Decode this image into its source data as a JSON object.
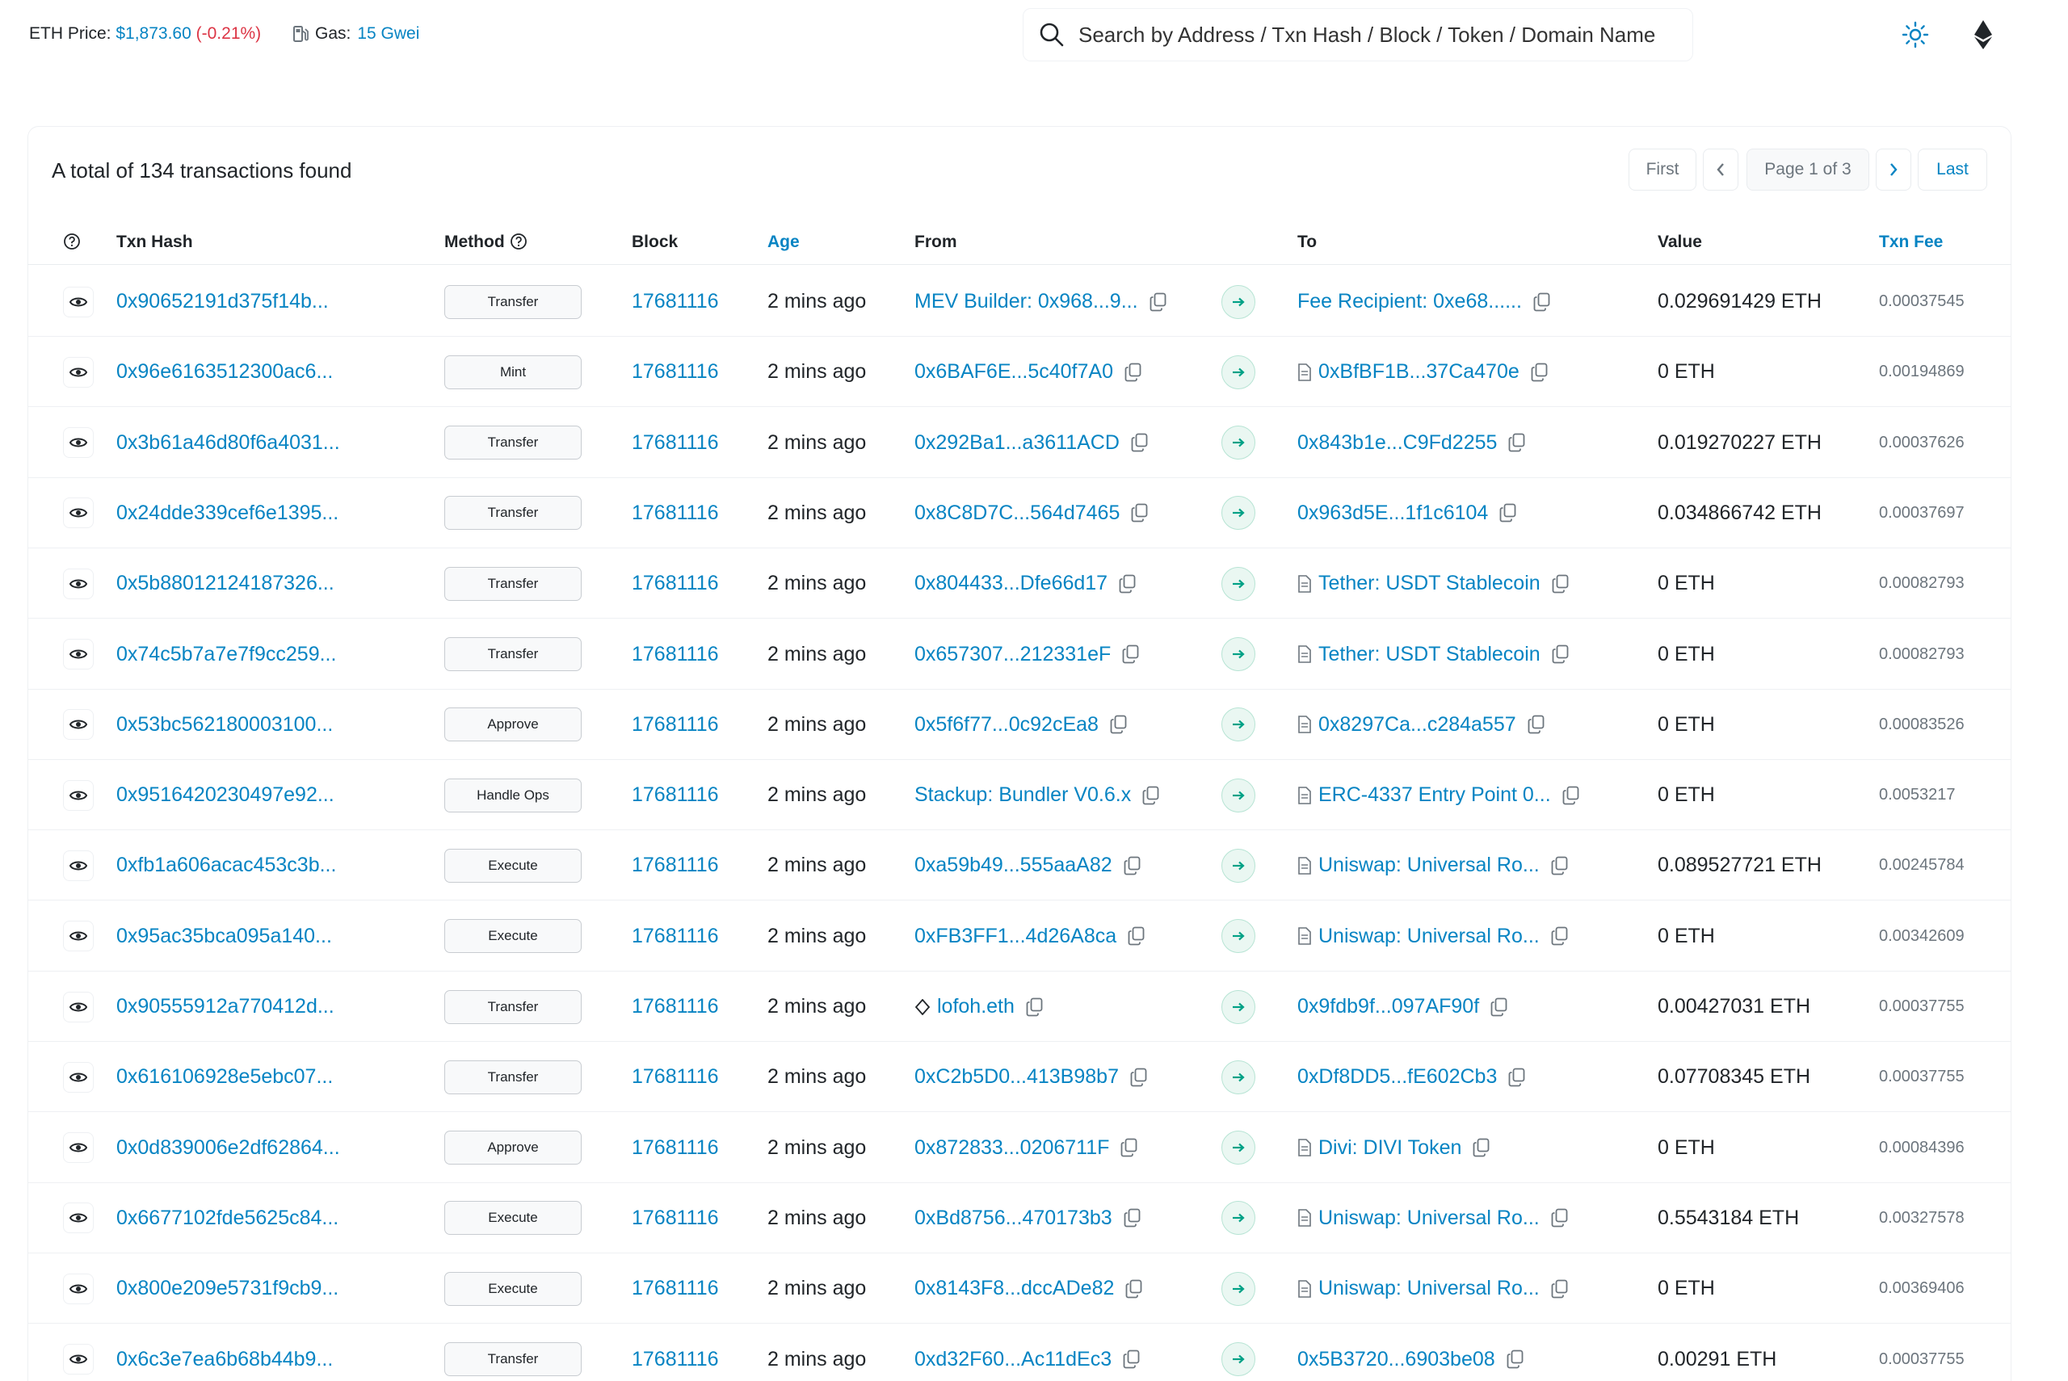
{
  "topbar": {
    "eth_price_label": "ETH Price:",
    "eth_price_value": "$1,873.60",
    "eth_price_change": "(-0.21%)",
    "gas_label": "Gas:",
    "gas_value": "15 Gwei",
    "search_placeholder": "Search by Address / Txn Hash / Block / Token / Domain Name"
  },
  "summary": {
    "total_text": "A total of 134 transactions found"
  },
  "pagination": {
    "first": "First",
    "page_info": "Page 1 of 3",
    "last": "Last"
  },
  "table": {
    "headers": {
      "txn_hash": "Txn Hash",
      "method": "Method",
      "block": "Block",
      "age": "Age",
      "from": "From",
      "to": "To",
      "value": "Value",
      "txn_fee": "Txn Fee"
    },
    "rows": [
      {
        "hash": "0x90652191d375f14b...",
        "method": "Transfer",
        "block": "17681116",
        "age": "2 mins ago",
        "from": "MEV Builder: 0x968...9...",
        "from_type": "addr",
        "to": "Fee Recipient: 0xe68......",
        "to_type": "addr",
        "value": "0.029691429 ETH",
        "fee": "0.00037545"
      },
      {
        "hash": "0x96e6163512300ac6...",
        "method": "Mint",
        "block": "17681116",
        "age": "2 mins ago",
        "from": "0x6BAF6E...5c40f7A0",
        "from_type": "addr",
        "to": "0xBfBF1B...37Ca470e",
        "to_type": "contract",
        "value": "0 ETH",
        "fee": "0.00194869"
      },
      {
        "hash": "0x3b61a46d80f6a4031...",
        "method": "Transfer",
        "block": "17681116",
        "age": "2 mins ago",
        "from": "0x292Ba1...a3611ACD",
        "from_type": "addr",
        "to": "0x843b1e...C9Fd2255",
        "to_type": "addr",
        "value": "0.019270227 ETH",
        "fee": "0.00037626"
      },
      {
        "hash": "0x24dde339cef6e1395...",
        "method": "Transfer",
        "block": "17681116",
        "age": "2 mins ago",
        "from": "0x8C8D7C...564d7465",
        "from_type": "addr",
        "to": "0x963d5E...1f1c6104",
        "to_type": "addr",
        "value": "0.034866742 ETH",
        "fee": "0.00037697"
      },
      {
        "hash": "0x5b88012124187326...",
        "method": "Transfer",
        "block": "17681116",
        "age": "2 mins ago",
        "from": "0x804433...Dfe66d17",
        "from_type": "addr",
        "to": "Tether: USDT Stablecoin",
        "to_type": "contract",
        "value": "0 ETH",
        "fee": "0.00082793"
      },
      {
        "hash": "0x74c5b7a7e7f9cc259...",
        "method": "Transfer",
        "block": "17681116",
        "age": "2 mins ago",
        "from": "0x657307...212331eF",
        "from_type": "addr",
        "to": "Tether: USDT Stablecoin",
        "to_type": "contract",
        "value": "0 ETH",
        "fee": "0.00082793"
      },
      {
        "hash": "0x53bc562180003100...",
        "method": "Approve",
        "block": "17681116",
        "age": "2 mins ago",
        "from": "0x5f6f77...0c92cEa8",
        "from_type": "addr",
        "to": "0x8297Ca...c284a557",
        "to_type": "contract",
        "value": "0 ETH",
        "fee": "0.00083526"
      },
      {
        "hash": "0x9516420230497e92...",
        "method": "Handle Ops",
        "block": "17681116",
        "age": "2 mins ago",
        "from": "Stackup: Bundler V0.6.x",
        "from_type": "addr",
        "to": "ERC-4337 Entry Point 0...",
        "to_type": "contract",
        "value": "0 ETH",
        "fee": "0.0053217"
      },
      {
        "hash": "0xfb1a606acac453c3b...",
        "method": "Execute",
        "block": "17681116",
        "age": "2 mins ago",
        "from": "0xa59b49...555aaA82",
        "from_type": "addr",
        "to": "Uniswap: Universal Ro...",
        "to_type": "contract",
        "value": "0.089527721 ETH",
        "fee": "0.00245784"
      },
      {
        "hash": "0x95ac35bca095a140...",
        "method": "Execute",
        "block": "17681116",
        "age": "2 mins ago",
        "from": "0xFB3FF1...4d26A8ca",
        "from_type": "addr",
        "to": "Uniswap: Universal Ro...",
        "to_type": "contract",
        "value": "0 ETH",
        "fee": "0.00342609"
      },
      {
        "hash": "0x90555912a770412d...",
        "method": "Transfer",
        "block": "17681116",
        "age": "2 mins ago",
        "from": "lofoh.eth",
        "from_type": "ens",
        "to": "0x9fdb9f...097AF90f",
        "to_type": "addr",
        "value": "0.00427031 ETH",
        "fee": "0.00037755"
      },
      {
        "hash": "0x616106928e5ebc07...",
        "method": "Transfer",
        "block": "17681116",
        "age": "2 mins ago",
        "from": "0xC2b5D0...413B98b7",
        "from_type": "addr",
        "to": "0xDf8DD5...fE602Cb3",
        "to_type": "addr",
        "value": "0.07708345 ETH",
        "fee": "0.00037755"
      },
      {
        "hash": "0x0d839006e2df62864...",
        "method": "Approve",
        "block": "17681116",
        "age": "2 mins ago",
        "from": "0x872833...0206711F",
        "from_type": "addr",
        "to": "Divi: DIVI Token",
        "to_type": "contract",
        "value": "0 ETH",
        "fee": "0.00084396"
      },
      {
        "hash": "0x6677102fde5625c84...",
        "method": "Execute",
        "block": "17681116",
        "age": "2 mins ago",
        "from": "0xBd8756...470173b3",
        "from_type": "addr",
        "to": "Uniswap: Universal Ro...",
        "to_type": "contract",
        "value": "0.5543184 ETH",
        "fee": "0.00327578"
      },
      {
        "hash": "0x800e209e5731f9cb9...",
        "method": "Execute",
        "block": "17681116",
        "age": "2 mins ago",
        "from": "0x8143F8...dccADe82",
        "from_type": "addr",
        "to": "Uniswap: Universal Ro...",
        "to_type": "contract",
        "value": "0 ETH",
        "fee": "0.00369406"
      },
      {
        "hash": "0x6c3e7ea6b68b44b9...",
        "method": "Transfer",
        "block": "17681116",
        "age": "2 mins ago",
        "from": "0xd32F60...Ac11dEc3",
        "from_type": "addr",
        "to": "0x5B3720...6903be08",
        "to_type": "addr",
        "value": "0.00291 ETH",
        "fee": "0.00037755"
      }
    ]
  }
}
